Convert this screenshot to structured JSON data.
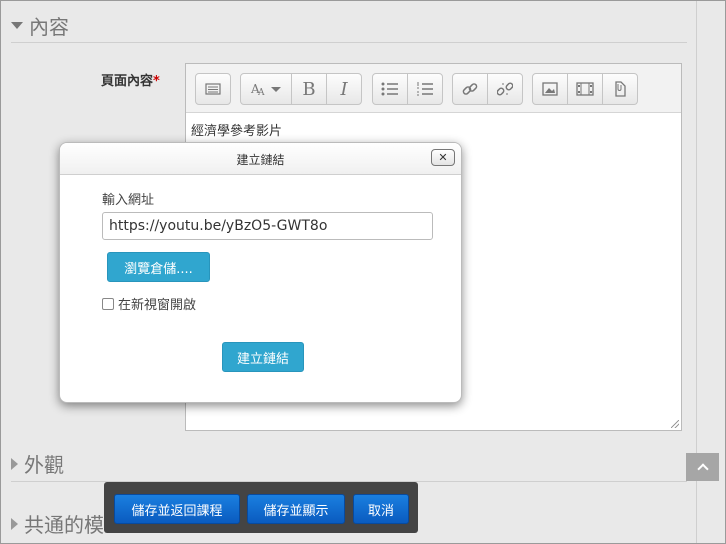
{
  "sections": {
    "content_title": "內容",
    "appearance_title": "外觀",
    "common_title": "共通的模"
  },
  "form": {
    "page_content_label": "頁面內容",
    "required_mark": "*"
  },
  "editor": {
    "text": "經濟學參考影片",
    "toolbar_icons": [
      "toolbar-toggle-icon",
      "font-size-icon",
      "bold-icon",
      "italic-icon",
      "bullet-list-icon",
      "numbered-list-icon",
      "link-icon",
      "unlink-icon",
      "image-icon",
      "media-icon",
      "file-icon"
    ],
    "bold_glyph": "B",
    "italic_glyph": "I"
  },
  "dialog": {
    "title": "建立鏈結",
    "close_glyph": "✕",
    "url_label": "輸入網址",
    "url_value": "https://youtu.be/yBzO5-GWT8o",
    "browse_button": "瀏覽倉儲....",
    "new_window_label": "在新視窗開啟",
    "new_window_checked": false,
    "create_button": "建立鏈結"
  },
  "bottom_bar": {
    "save_return": "儲存並返回課程",
    "save_display": "儲存並顯示",
    "cancel": "取消"
  },
  "colors": {
    "primary_button": "#0a5bbf",
    "info_button": "#30a6cf",
    "required": "#cc0000"
  }
}
